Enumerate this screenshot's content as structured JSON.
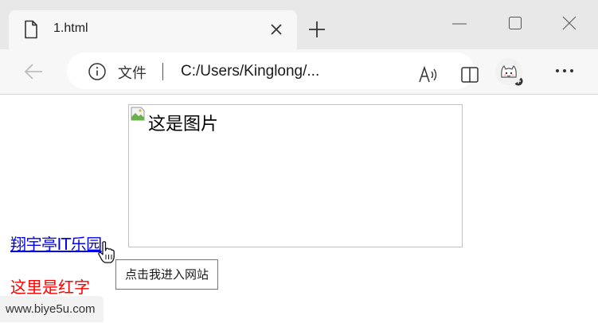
{
  "browser": {
    "tab_title": "1.html",
    "address": {
      "security_label": "文件",
      "url": "C:/Users/Kinglong/..."
    },
    "icons": {
      "tab": "file-icon",
      "close_tab": "close-icon",
      "new_tab": "plus-icon",
      "back": "back-arrow-icon",
      "info": "info-icon",
      "read_aloud": "read-aloud-icon",
      "split_screen": "split-screen-icon",
      "favorites": "add-favorite-icon",
      "profile": "cat-avatar",
      "menu": "more-icon"
    }
  },
  "page": {
    "image_alt": "这是图片",
    "link_text": "翔宇亭IT乐园",
    "link_tooltip": "点击我进入网站",
    "red_text": "这里是红字",
    "red_text_color": "#ff0000",
    "link_color": "#0000ee"
  },
  "status_bar": {
    "text": "www.biye5u.com"
  }
}
